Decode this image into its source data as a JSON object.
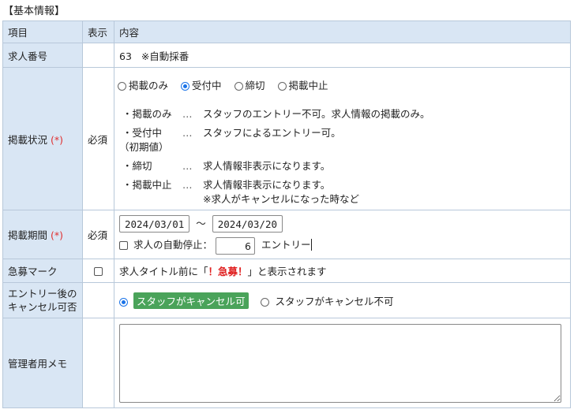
{
  "section_title": "【基本情報】",
  "table": {
    "headers": {
      "item": "項目",
      "display": "表示",
      "content": "内容"
    }
  },
  "job_number": {
    "label": "求人番号",
    "value": "63",
    "note": "※自動採番"
  },
  "status": {
    "label": "掲載状況",
    "required_mark": "(*)",
    "display": "必須",
    "options": [
      {
        "label": "掲載のみ",
        "selected": false
      },
      {
        "label": "受付中",
        "selected": true
      },
      {
        "label": "締切",
        "selected": false
      },
      {
        "label": "掲載中止",
        "selected": false
      }
    ],
    "descriptions": [
      {
        "bullet": "・掲載のみ",
        "dots": "…",
        "text": "スタッフのエントリー不可。求人情報の掲載のみ。"
      },
      {
        "bullet": "・受付中",
        "dots": "…",
        "text": "スタッフによるエントリー可。"
      },
      {
        "bullet": "（初期値）",
        "dots": "",
        "text": ""
      },
      {
        "bullet": "・締切",
        "dots": "…",
        "text": "求人情報非表示になります。"
      },
      {
        "bullet": "・掲載中止",
        "dots": "…",
        "text": "求人情報非表示になります。"
      },
      {
        "bullet": "",
        "dots": "",
        "text": "※求人がキャンセルになった時など"
      }
    ]
  },
  "period": {
    "label": "掲載期間",
    "required_mark": "(*)",
    "display": "必須",
    "start_date": "2024/03/01",
    "separator": "～",
    "end_date": "2024/03/20",
    "auto_stop_label": "求人の自動停止：",
    "auto_stop_value": "6",
    "auto_stop_unit": "エントリー",
    "auto_stop_checked": false
  },
  "urgent": {
    "label": "急募マーク",
    "checked": false,
    "prefix": "求人タイトル前に「",
    "mark": "！急募！",
    "suffix": "」と表示されます"
  },
  "cancel": {
    "label_line1": "エントリー後の",
    "label_line2": "キャンセル可否",
    "options": [
      {
        "label": "スタッフがキャンセル可",
        "selected": true
      },
      {
        "label": "スタッフがキャンセル不可",
        "selected": false
      }
    ]
  },
  "memo": {
    "label": "管理者用メモ",
    "value": ""
  },
  "colors": {
    "header_bg": "#d9e6f4",
    "border": "#b8c8da",
    "required": "#e03030",
    "selected_green": "#4aa35a",
    "urgent_red": "#e02020"
  }
}
